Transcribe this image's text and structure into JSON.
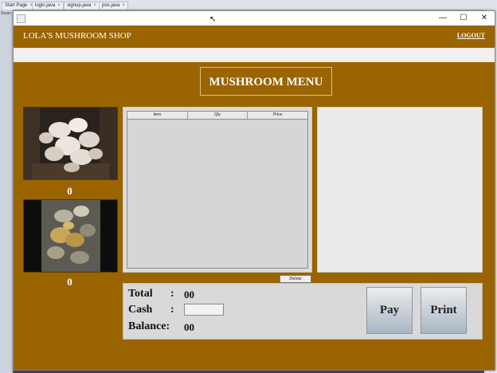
{
  "ide": {
    "tabs": [
      "Start Page",
      "login.java",
      "signup.java",
      "pos.java"
    ],
    "side_label": "Sourc"
  },
  "window": {
    "controls": {
      "minimize": "—",
      "maximize": "☐",
      "close": "✕"
    }
  },
  "header": {
    "shop_name": "LOLA'S MUSHROOM SHOP",
    "logout_label": "LOGOUT"
  },
  "menu": {
    "title": "MUSHROOM MENU",
    "items": [
      {
        "image": "white-oyster-mushroom-photo",
        "count": "0"
      },
      {
        "image": "golden-mushroom-photo",
        "count": "0"
      }
    ]
  },
  "order_table": {
    "columns": [
      "Item",
      "Qty",
      "Price"
    ],
    "rows": []
  },
  "delete_label": "Delete",
  "summary": {
    "total_label": "Total",
    "total_value": "00",
    "cash_label": "Cash",
    "cash_value": "",
    "balance_label": "Balance:",
    "balance_value": "00",
    "colon": ":"
  },
  "actions": {
    "pay_label": "Pay",
    "print_label": "Print"
  },
  "colors": {
    "brand": "#9a6400",
    "panel": "#d9d9d9"
  }
}
